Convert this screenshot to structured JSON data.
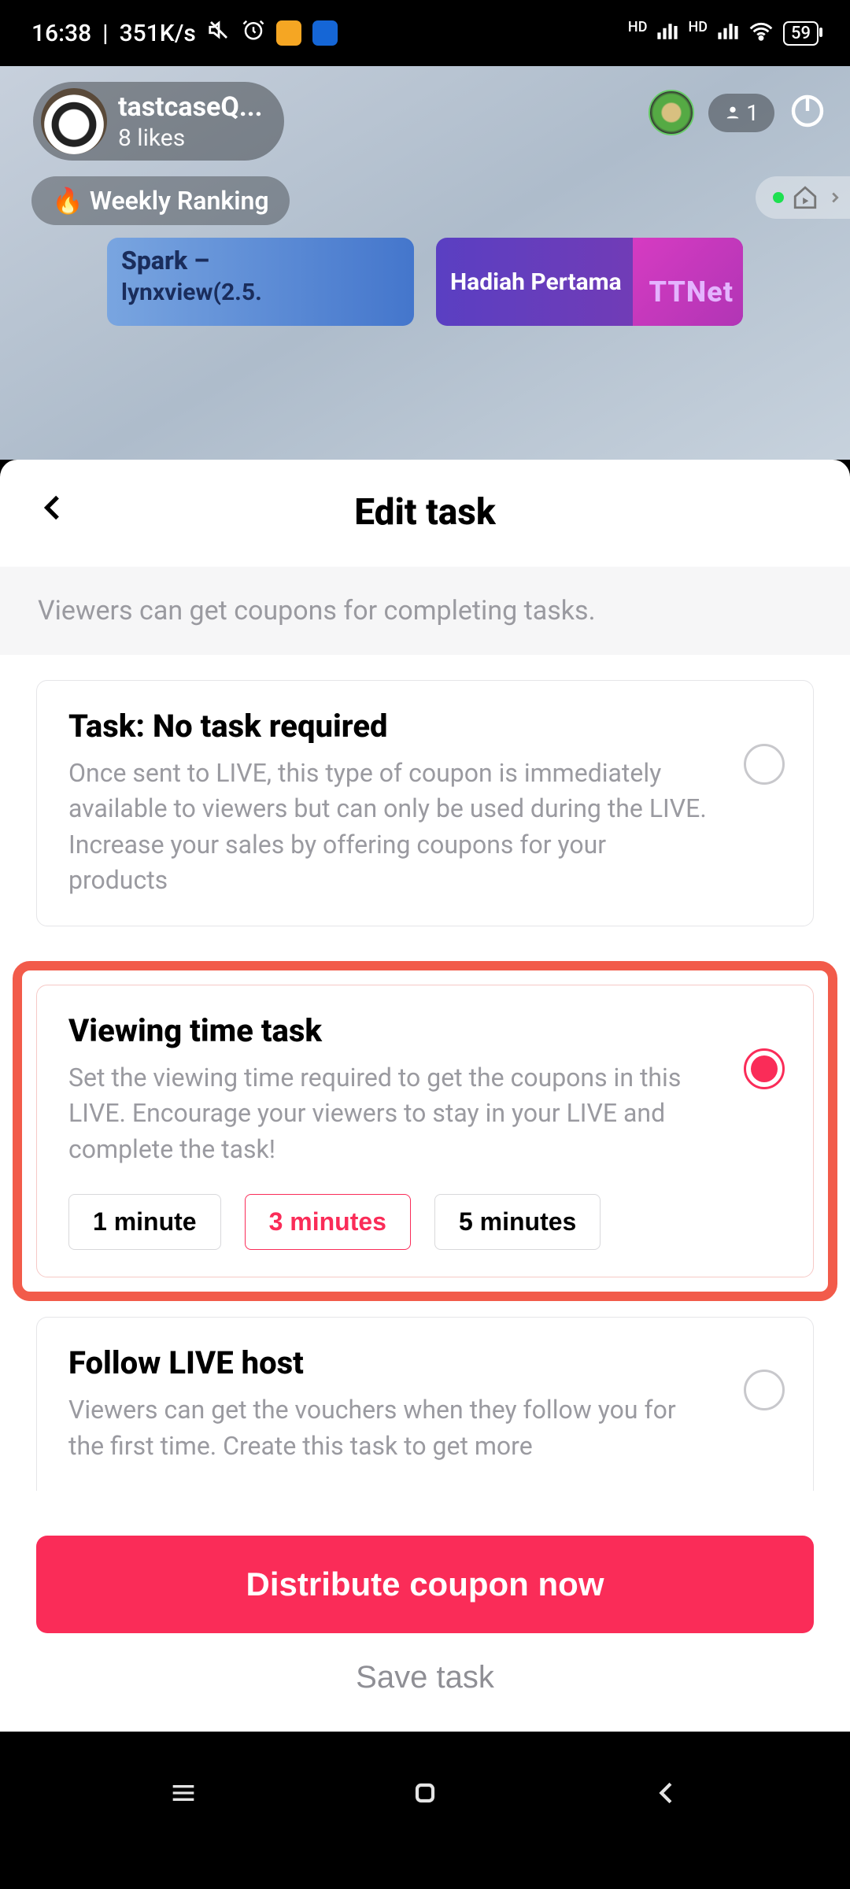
{
  "statusbar": {
    "time": "16:38",
    "speed": "351K/s",
    "battery": "59"
  },
  "live": {
    "host_name": "tastcaseQ...",
    "likes_label": "8 likes",
    "viewer_count": "1",
    "weekly_ranking": "Weekly Ranking",
    "promo_blue_line1": "Spark –",
    "promo_blue_line2": "lynxview(2.5.",
    "promo_purple_line1": "Hadiah Pertama",
    "promo_purple_badge": "TTNet"
  },
  "sheet": {
    "title": "Edit task",
    "subtitle": "Viewers can get coupons for completing tasks.",
    "task_none": {
      "title": "Task: No task required",
      "desc": "Once sent to LIVE, this type of coupon is immediately available to viewers but can only be used during the LIVE. Increase your sales by offering coupons for your products",
      "selected": false
    },
    "task_viewing": {
      "title": "Viewing time task",
      "desc": "Set the viewing time required to get the coupons in this LIVE. Encourage your viewers to stay in your LIVE and complete the task!",
      "selected": true,
      "options": [
        "1 minute",
        "3 minutes",
        "5 minutes"
      ],
      "selected_option_index": 1
    },
    "task_follow": {
      "title": "Follow LIVE host",
      "desc": "Viewers can get the vouchers when they follow you for the first time. Create this task to get more",
      "selected": false
    },
    "distribute_label": "Distribute coupon now",
    "save_label": "Save task"
  }
}
